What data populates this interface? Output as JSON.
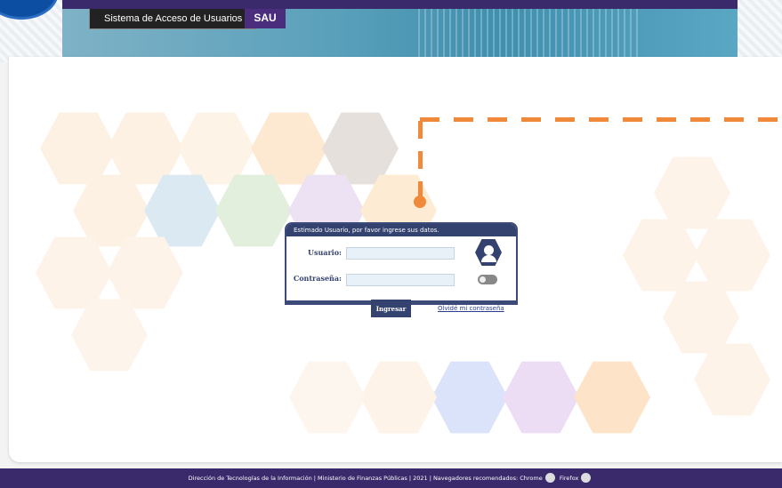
{
  "header": {
    "system_name": "Sistema de Acceso de Usuarios",
    "system_acronym": "SAU"
  },
  "login": {
    "prompt": "Estimado Usuario, por favor ingrese sus datos.",
    "user_label": "Usuario:",
    "password_label": "Contraseña:",
    "user_value": "",
    "password_value": "",
    "submit_label": "Ingresar",
    "forgot_label": "Olvidé mi contraseña"
  },
  "footer": {
    "text": "Dirección de Tecnologías de la Información | Ministerio de Finanzas Públicas | 2021 | Navegadores recomendados:",
    "browser_chrome": "Chrome",
    "browser_firefox": "Firefox"
  },
  "icons": {
    "logo": "institution-logo-icon",
    "user": "user-icon",
    "toggle": "toggle-icon",
    "chrome": "chrome-icon",
    "firefox": "firefox-icon"
  },
  "colors": {
    "primary": "#34426f",
    "header_band": "#3a2a6b",
    "accent": "#f08a3a",
    "sau_tag": "#4a2d7d"
  }
}
